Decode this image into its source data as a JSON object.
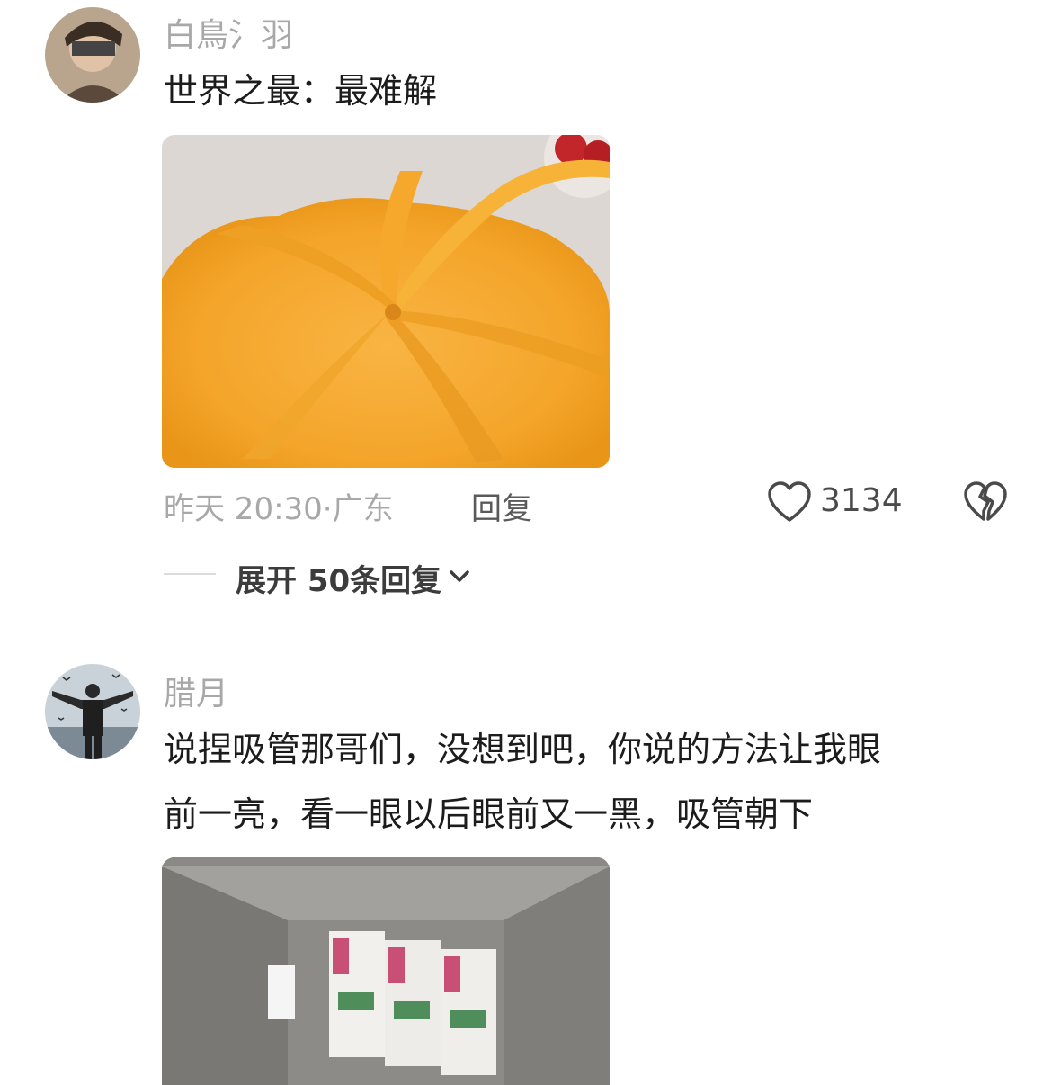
{
  "comments": [
    {
      "username": "白鳥氵羽",
      "text": "世界之最：最难解",
      "time": "昨天 20:30",
      "location": "广东",
      "reply_label": "回复",
      "likes": "3134",
      "expand_label": "展开 50条回复"
    },
    {
      "username": "腊月",
      "text_line1": "说捏吸管那哥们，没想到吧，你说的方法让我眼",
      "text_line2": "前一亮，看一眼以后眼前又一黑，吸管朝下"
    }
  ],
  "icons": {
    "like": "heart-outline-icon",
    "dislike": "broken-heart-icon",
    "expand": "chevron-down-icon"
  },
  "colors": {
    "text": "#1c1c1c",
    "meta": "#a8a8a8",
    "bag": "#f5a623"
  }
}
